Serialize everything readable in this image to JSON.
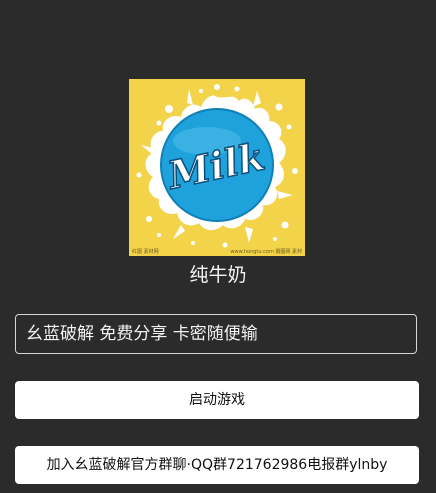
{
  "app": {
    "logo_text": "Milk",
    "logo_footer_left": "红图 素材网",
    "logo_footer_right": "www.hongtu.com 摄图网 素材",
    "title": "纯牛奶"
  },
  "card_field": {
    "value": "幺蓝破解 免费分享 卡密随便输"
  },
  "buttons": {
    "start_label": "启动游戏",
    "join_label": "加入幺蓝破解官方群聊·QQ群721762986电报群ylnby"
  },
  "colors": {
    "background": "#2b2b2b",
    "logo_yellow": "#f2d34a",
    "logo_blue": "#1fa2dc",
    "button_bg": "#ffffff"
  }
}
